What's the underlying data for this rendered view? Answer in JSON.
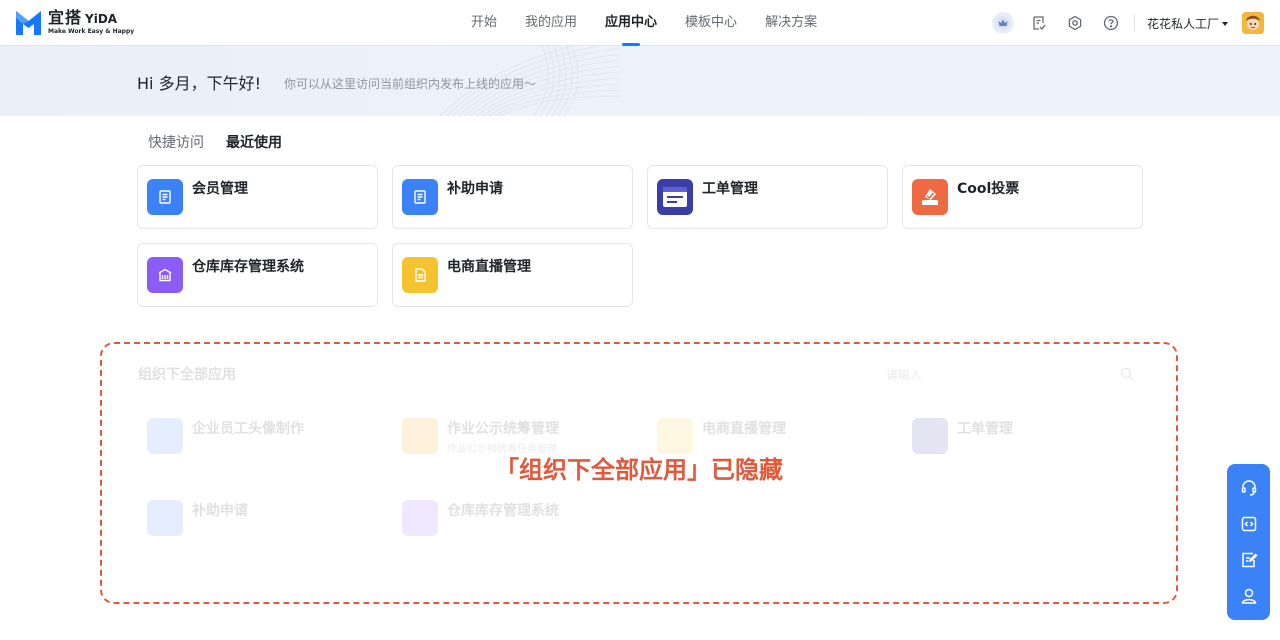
{
  "app": {
    "logo_title": "宜搭",
    "logo_brand": "YiDA",
    "logo_slogan": "Make Work Easy & Happy"
  },
  "nav": [
    {
      "label": "开始",
      "active": false
    },
    {
      "label": "我的应用",
      "active": false
    },
    {
      "label": "应用中心",
      "active": true
    },
    {
      "label": "模板中心",
      "active": false
    },
    {
      "label": "解决方案",
      "active": false
    }
  ],
  "header": {
    "icons": [
      "crown-icon",
      "tasks-icon",
      "gear-icon",
      "help-icon"
    ],
    "user_name": "花花私人工厂"
  },
  "banner": {
    "greeting": "Hi 多月，下午好!",
    "subtitle": "你可以从这里访问当前组织内发布上线的应用～"
  },
  "tabs": [
    {
      "label": "快捷访问",
      "active": false
    },
    {
      "label": "最近使用",
      "active": true
    }
  ],
  "recent_apps": [
    {
      "name": "会员管理",
      "icon": "document-icon",
      "color": "#3b82f6"
    },
    {
      "name": "补助申请",
      "icon": "document-icon",
      "color": "#3b82f6"
    },
    {
      "name": "工单管理",
      "icon": "ticket-icon",
      "color": "#3a3fa8"
    },
    {
      "name": "Cool投票",
      "icon": "vote-icon",
      "color": "#ef6a43"
    },
    {
      "name": "仓库库存管理系统",
      "icon": "warehouse-icon",
      "color": "#8b5cf6"
    },
    {
      "name": "电商直播管理",
      "icon": "file-icon",
      "color": "#f5c330"
    }
  ],
  "all_apps_section": {
    "title": "组织下全部应用",
    "search_placeholder": "请输入",
    "hidden_notice": "「组织下全部应用」已隐藏",
    "apps": [
      {
        "name": "企业员工头像制作",
        "desc": "",
        "color": "#3b82f6"
      },
      {
        "name": "作业公示统筹管理",
        "desc": "作业公示和统筹任务管理",
        "color": "#f59e0b"
      },
      {
        "name": "电商直播管理",
        "desc": "",
        "color": "#f5c330"
      },
      {
        "name": "工单管理",
        "desc": "",
        "color": "#3a3fa8"
      },
      {
        "name": "补助申请",
        "desc": "",
        "color": "#3b82f6"
      },
      {
        "name": "仓库库存管理系统",
        "desc": "",
        "color": "#8b5cf6"
      }
    ]
  },
  "float_bar": {
    "icons": [
      "support-icon",
      "code-icon",
      "edit-icon",
      "user-icon"
    ],
    "color": "#3b82f6"
  }
}
